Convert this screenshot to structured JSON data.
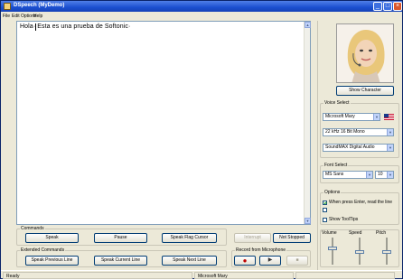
{
  "window": {
    "title": "DSpeech (MyDemo)"
  },
  "menu": [
    "File",
    "Edit",
    "Options",
    "Help"
  ],
  "editor": {
    "text": "Hola· Esta es una prueba de Softonic·"
  },
  "commands": {
    "label": "Commands",
    "speak": "Speak",
    "pause": "Pause",
    "speak_flag": "Speak Flag Cursor",
    "interrupt": "Interrupt",
    "not_stopped": "Not Stopped"
  },
  "extended": {
    "label": "Extended Commands",
    "speak_previous": "Speak Previous Line",
    "speak_current": "Speak Current Line",
    "speak_next": "Speak Next Line"
  },
  "recorder": {
    "label": "Record from Microphone",
    "record": "●",
    "play": "▶",
    "stop": "■"
  },
  "character": {
    "button": "Show Character"
  },
  "voice": {
    "label": "Voice Select",
    "engine": "Microsoft Mary",
    "format": "22 kHz 16 Bit Mono",
    "device": "SoundMAX Digital Audio",
    "flag_icon": "us-flag-icon"
  },
  "font": {
    "label": "Font Select",
    "name": "MS Sans",
    "size": "10"
  },
  "options": {
    "label": "Options",
    "opt1": "When press Enter, read the line",
    "opt2": "",
    "tooltip": "Show ToolTips"
  },
  "sliders": {
    "volume": "Volume",
    "speed": "Speed",
    "pitch": "Pitch"
  },
  "status": {
    "left": "Ready",
    "mid": "Microsoft Mary",
    "right": ""
  },
  "colors": {
    "title": "#1b4fd0",
    "accent": "#003c74"
  }
}
